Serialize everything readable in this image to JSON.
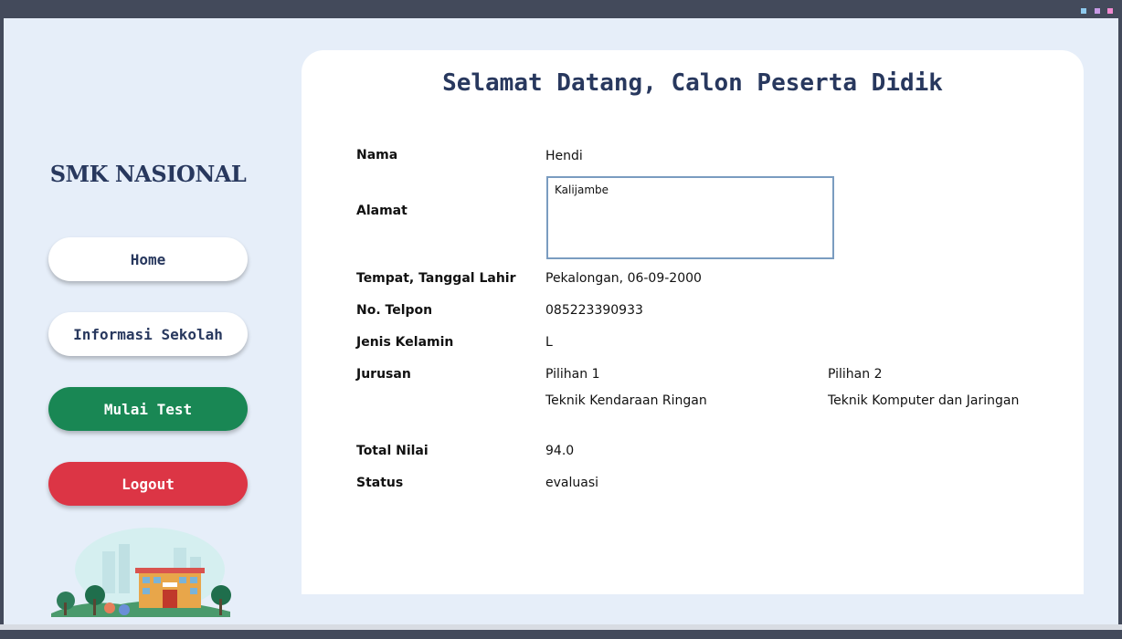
{
  "window": {
    "controls": [
      "minimize",
      "maximize",
      "close"
    ]
  },
  "sidebar": {
    "school_name": "SMK NASIONAL",
    "buttons": {
      "home": "Home",
      "info": "Informasi Sekolah",
      "test": "Mulai Test",
      "logout": "Logout"
    }
  },
  "main": {
    "heading": "Selamat Datang, Calon Peserta Didik",
    "labels": {
      "nama": "Nama",
      "alamat": "Alamat",
      "ttl": "Tempat, Tanggal Lahir",
      "telpon": "No. Telpon",
      "jenis_kelamin": "Jenis Kelamin",
      "jurusan": "Jurusan",
      "total_nilai": "Total Nilai",
      "status": "Status"
    },
    "values": {
      "nama": "Hendi",
      "alamat": "Kalijambe",
      "ttl": "Pekalongan, 06-09-2000",
      "telpon": "085223390933",
      "jenis_kelamin": "L",
      "pilihan1_label": "Pilihan 1",
      "pilihan1_value": "Teknik Kendaraan Ringan",
      "pilihan2_label": "Pilihan 2",
      "pilihan2_value": "Teknik Komputer dan Jaringan",
      "total_nilai": "94.0",
      "status": "evaluasi"
    }
  },
  "colors": {
    "background": "#e6eef9",
    "navy": "#28385e",
    "success": "#198754",
    "danger": "#dc3545",
    "titlebar": "#434a5b"
  }
}
